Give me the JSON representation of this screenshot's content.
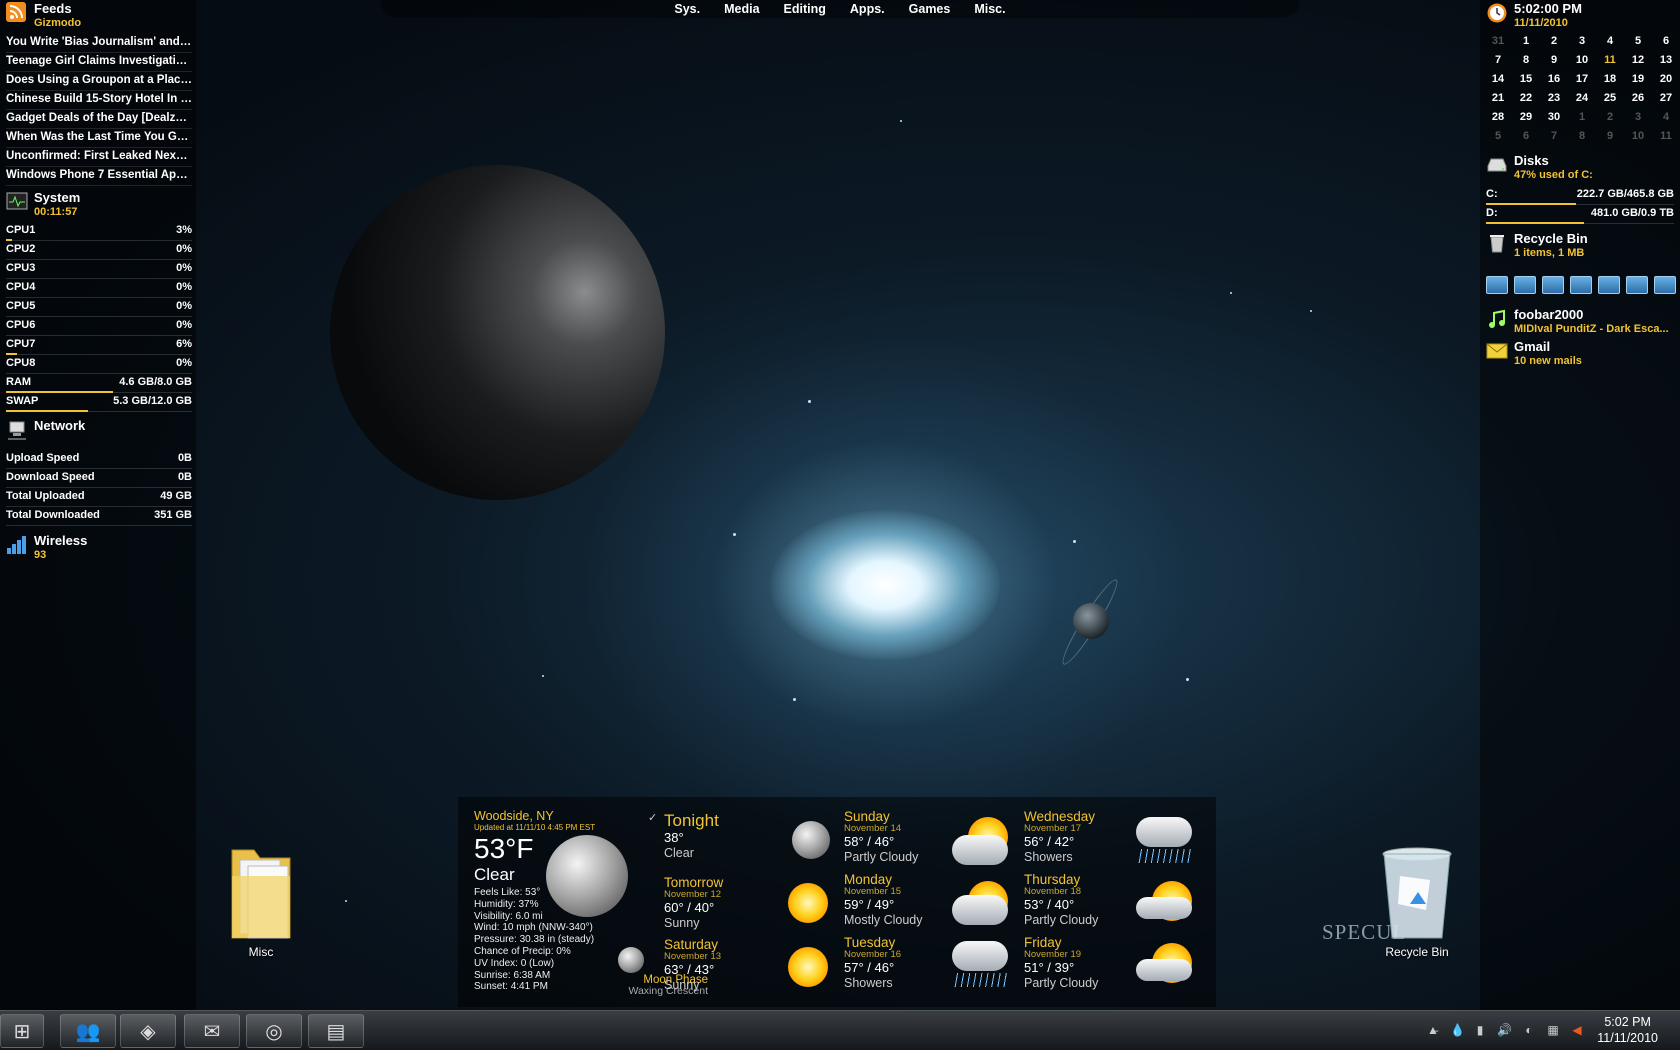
{
  "menu": [
    "Sys.",
    "Media",
    "Editing",
    "Apps.",
    "Games",
    "Misc."
  ],
  "feeds": {
    "title": "Feeds",
    "source": "Gizmodo",
    "items": [
      "You Write 'Bias Journalism' and I...",
      "Teenage Girl Claims Investigative...",
      "Does Using a Groupon at a Place...",
      "Chinese Build 15-Story Hotel In Ju...",
      "Gadget Deals of the Day [Dealzm...",
      "When Was the Last Time You Gav...",
      "Unconfirmed: First Leaked Nexus...",
      "Windows Phone 7 Essential Apps,..."
    ]
  },
  "system": {
    "title": "System",
    "uptime": "00:11:57",
    "meters": [
      {
        "label": "CPU1",
        "value": "3%",
        "level": 0.03
      },
      {
        "label": "CPU2",
        "value": "0%",
        "level": 0
      },
      {
        "label": "CPU3",
        "value": "0%",
        "level": 0
      },
      {
        "label": "CPU4",
        "value": "0%",
        "level": 0
      },
      {
        "label": "CPU5",
        "value": "0%",
        "level": 0
      },
      {
        "label": "CPU6",
        "value": "0%",
        "level": 0
      },
      {
        "label": "CPU7",
        "value": "6%",
        "level": 0.06
      },
      {
        "label": "CPU8",
        "value": "0%",
        "level": 0
      },
      {
        "label": "RAM",
        "value": "4.6 GB/8.0 GB",
        "level": 0.575
      },
      {
        "label": "SWAP",
        "value": "5.3 GB/12.0 GB",
        "level": 0.44
      }
    ]
  },
  "network": {
    "title": "Network",
    "rows": [
      {
        "label": "Upload Speed",
        "value": "0B"
      },
      {
        "label": "Download Speed",
        "value": "0B"
      },
      {
        "label": "Total Uploaded",
        "value": "49 GB"
      },
      {
        "label": "Total Downloaded",
        "value": "351 GB"
      }
    ]
  },
  "wireless": {
    "title": "Wireless",
    "value": "93"
  },
  "clock": {
    "time": "5:02:00 PM",
    "date": "11/11/2010"
  },
  "calendar": [
    [
      "31",
      "1",
      "2",
      "3",
      "4",
      "5",
      "6"
    ],
    [
      "7",
      "8",
      "9",
      "10",
      "11",
      "12",
      "13"
    ],
    [
      "14",
      "15",
      "16",
      "17",
      "18",
      "19",
      "20"
    ],
    [
      "21",
      "22",
      "23",
      "24",
      "25",
      "26",
      "27"
    ],
    [
      "28",
      "29",
      "30",
      "1",
      "2",
      "3",
      "4"
    ],
    [
      "5",
      "6",
      "7",
      "8",
      "9",
      "10",
      "11"
    ]
  ],
  "disks": {
    "title": "Disks",
    "summary": "47% used of C:",
    "drives": [
      {
        "label": "C:",
        "value": "222.7 GB/465.8 GB",
        "level": 0.48
      },
      {
        "label": "D:",
        "value": "481.0 GB/0.9 TB",
        "level": 0.52
      }
    ]
  },
  "recycle": {
    "title": "Recycle Bin",
    "summary": "1 items, 1 MB"
  },
  "music": {
    "title": "foobar2000",
    "track": "MIDIval PunditZ - Dark Esca..."
  },
  "mail": {
    "title": "Gmail",
    "summary": "10 new mails"
  },
  "weather": {
    "location": "Woodside, NY",
    "updated": "Updated at 11/11/10 4:45 PM EST",
    "temp": "53°F",
    "condition": "Clear",
    "details": [
      "Feels Like: 53°",
      "Humidity: 37%",
      "Visibility: 6.0 mi",
      "Wind: 10 mph (NNW-340°)",
      "Pressure: 30.38 in (steady)",
      "Chance of Precip: 0%",
      "UV Index: 0 (Low)",
      "Sunrise: 6:38 AM",
      "Sunset: 4:41 PM"
    ],
    "moon_label": "Moon Phase",
    "moon_phase": "Waxing Crescent",
    "forecast": [
      {
        "day": "Tonight",
        "date": "",
        "temp": "38°",
        "cond": "Clear"
      },
      {
        "day": "Tomorrow",
        "date": "November 12",
        "temp": "60° / 40°",
        "cond": "Sunny"
      },
      {
        "day": "Saturday",
        "date": "November 13",
        "temp": "63° / 43°",
        "cond": "Sunny"
      },
      {
        "day": "Sunday",
        "date": "November 14",
        "temp": "58° / 46°",
        "cond": "Partly Cloudy"
      },
      {
        "day": "Monday",
        "date": "November 15",
        "temp": "59° / 49°",
        "cond": "Mostly Cloudy"
      },
      {
        "day": "Tuesday",
        "date": "November 16",
        "temp": "57° / 46°",
        "cond": "Showers"
      },
      {
        "day": "Wednesday",
        "date": "November 17",
        "temp": "56° / 42°",
        "cond": "Showers"
      },
      {
        "day": "Thursday",
        "date": "November 18",
        "temp": "53° / 40°",
        "cond": "Partly Cloudy"
      },
      {
        "day": "Friday",
        "date": "November 19",
        "temp": "51° / 39°",
        "cond": "Partly Cloudy"
      }
    ]
  },
  "desktop": {
    "folder": "Misc",
    "bin": "Recycle Bin",
    "watermark": "SPECUL"
  },
  "taskbar": {
    "time": "5:02 PM",
    "date": "11/11/2010"
  },
  "colors": {
    "accent": "#f2c233"
  }
}
